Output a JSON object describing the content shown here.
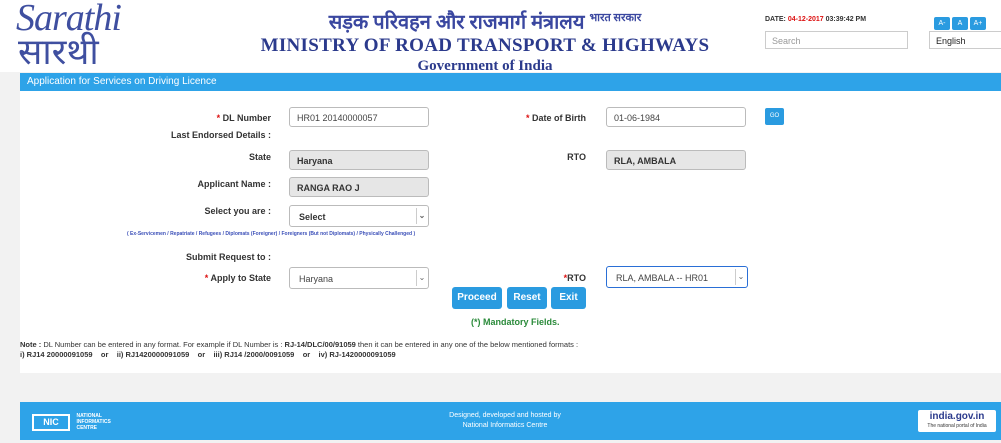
{
  "header": {
    "logo_line1": "Sarathi",
    "logo_line2": "सारथी",
    "hindi_title": "सड़क परिवहन और राजमार्ग मंत्रालय",
    "hindi_sup": "भारत सरकार",
    "ministry": "MINISTRY OF ROAD TRANSPORT & HIGHWAYS",
    "government": "Government of India",
    "date_label": "DATE:",
    "date_value": "04-12-2017",
    "time_value": "03:39:42 PM",
    "font_buttons": [
      "A-",
      "A",
      "A+"
    ],
    "search_placeholder": "Search",
    "language": "English"
  },
  "section_title": "Application for Services on Driving Licence",
  "form": {
    "dl_label": "DL Number",
    "dl_value": "HR01 20140000057",
    "dob_label": "Date of Birth",
    "dob_value": "01-06-1984",
    "go_label": "GO",
    "last_endorsed": "Last Endorsed Details :",
    "state_label": "State",
    "state_value": "Haryana",
    "rto_label": "RTO",
    "rto_value": "RLA, AMBALA",
    "applicant_label": "Applicant Name :",
    "applicant_value": "RANGA RAO J",
    "select_label": "Select you are :",
    "select_value": "Select",
    "categories": "( Ex-Servicemen / Repatriate / Refugees / Diplomats (Foreigner) / Foreigners (But not Diplomats) / Physically Challenged )",
    "submit_label": "Submit Request to :",
    "apply_state_label": "Apply to State",
    "apply_state_value": "Haryana",
    "rto2_label": "RTO",
    "rto2_value": "RLA, AMBALA -- HR01",
    "required_mark": "*",
    "proceed": "Proceed",
    "reset": "Reset",
    "exit": "Exit",
    "mandatory": "(*) Mandatory Fields."
  },
  "note": {
    "label": "Note :",
    "text1": " DL Number can be entered in any format. For example if DL Number is : ",
    "example": "RJ-14/DLC/00/91059",
    "text2": " then it can be entered in any one of the below mentioned formats :",
    "formats": "i) RJ14 20000091059    or    ii) RJ1420000091059    or    iii) RJ14 /2000/0091059    or    iv) RJ-1420000091059"
  },
  "footer": {
    "nic_logo": "NIC",
    "nic_text1": "NATIONAL",
    "nic_text2": "INFORMATICS",
    "nic_text3": "CENTRE",
    "credit1": "Designed, developed and hosted by",
    "credit2": "National Informatics Centre",
    "portal_name": "india.gov.in",
    "portal_tag": "The national portal of India"
  }
}
